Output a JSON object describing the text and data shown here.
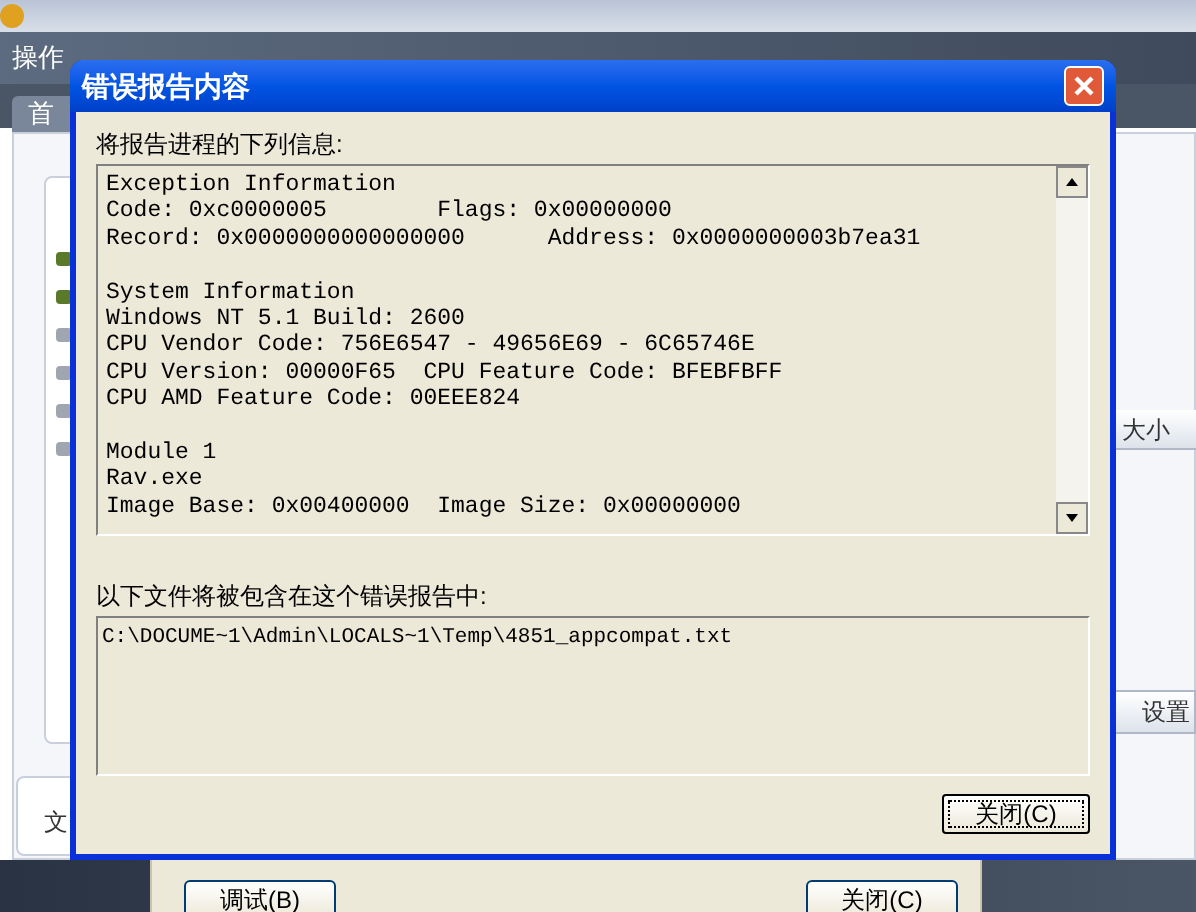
{
  "app": {
    "menu": [
      "操作"
    ],
    "tab": "首",
    "left_labels": [
      "文"
    ],
    "right_labels": [
      "大小",
      "设置"
    ]
  },
  "dialog": {
    "title": "错误报告内容",
    "report_label": "将报告进程的下列信息:",
    "report_sections": [
      [
        "Exception Information",
        "Code: 0xc0000005        Flags: 0x00000000",
        "Record: 0x0000000000000000      Address: 0x0000000003b7ea31"
      ],
      [
        "System Information",
        "Windows NT 5.1 Build: 2600",
        "CPU Vendor Code: 756E6547 - 49656E69 - 6C65746E",
        "CPU Version: 00000F65  CPU Feature Code: BFEBFBFF",
        "CPU AMD Feature Code: 00EEE824"
      ],
      [
        "Module 1",
        "Rav.exe",
        "Image Base: 0x00400000  Image Size: 0x00000000"
      ]
    ],
    "files_label": "以下文件将被包含在这个错误报告中:",
    "files": [
      "C:\\DOCUME~1\\Admin\\LOCALS~1\\Temp\\4851_appcompat.txt"
    ],
    "close_button": "关闭(C)"
  },
  "back_dialog": {
    "buttons": [
      "调试(B)",
      "关闭(C)"
    ]
  }
}
